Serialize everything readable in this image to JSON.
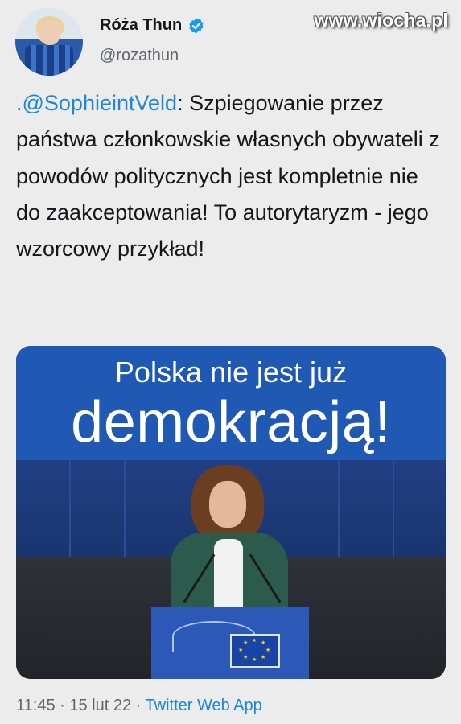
{
  "watermark": "www.wiocha.pl",
  "author": {
    "name": "Róża Thun",
    "handle": "@rozathun",
    "verified": true
  },
  "tweet": {
    "mention": ".@SophieintVeld",
    "text": ": Szpiegowanie przez państwa członkowskie własnych obywateli z powodów politycznych jest kompletnie nie do zaakceptowania! To autorytaryzm - jego wzorcowy przykład!"
  },
  "media": {
    "banner_line1": "Polska nie jest już",
    "banner_line2": "demokracją!"
  },
  "meta": {
    "time": "11:45",
    "separator1": " · ",
    "date": "15 lut 22",
    "separator2": " · ",
    "app": "Twitter Web App"
  },
  "colors": {
    "link": "#1d86d6",
    "banner": "#1f59b4",
    "verified": "#1d9bf0"
  },
  "icons": {
    "verified": "verified-badge-icon"
  }
}
